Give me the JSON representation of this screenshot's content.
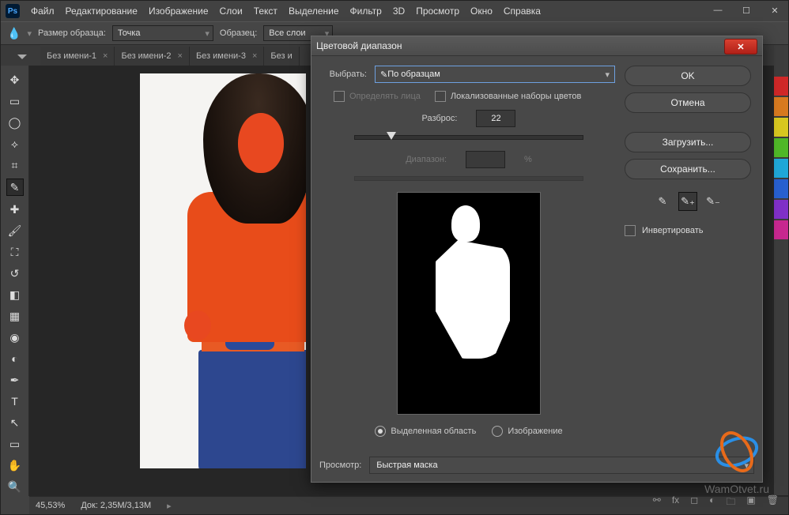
{
  "app": {
    "logo": "Ps"
  },
  "menu": [
    "Файл",
    "Редактирование",
    "Изображение",
    "Слои",
    "Текст",
    "Выделение",
    "Фильтр",
    "3D",
    "Просмотр",
    "Окно",
    "Справка"
  ],
  "toolbar": {
    "sample_size_label": "Размер образца:",
    "sample_size_value": "Точка",
    "sample_label": "Образец:",
    "sample_value": "Все слои"
  },
  "tabs": [
    "Без имени-1",
    "Без имени-2",
    "Без имени-3",
    "Без и"
  ],
  "status": {
    "zoom": "45,53%",
    "doc": "Док: 2,35M/3,13M"
  },
  "dialog": {
    "title": "Цветовой диапазон",
    "select_label": "Выбрать:",
    "select_value": "По образцам",
    "detect_faces": "Определять лица",
    "localized": "Локализованные наборы цветов",
    "fuzziness_label": "Разброс:",
    "fuzziness_value": "22",
    "range_label": "Диапазон:",
    "range_value": "",
    "range_unit": "%",
    "radio_selection": "Выделенная область",
    "radio_image": "Изображение",
    "preview_label": "Просмотр:",
    "preview_value": "Быстрая маска",
    "ok": "OK",
    "cancel": "Отмена",
    "load": "Загрузить...",
    "save": "Сохранить...",
    "invert": "Инвертировать"
  },
  "watermark": "WamOtvet.ru"
}
